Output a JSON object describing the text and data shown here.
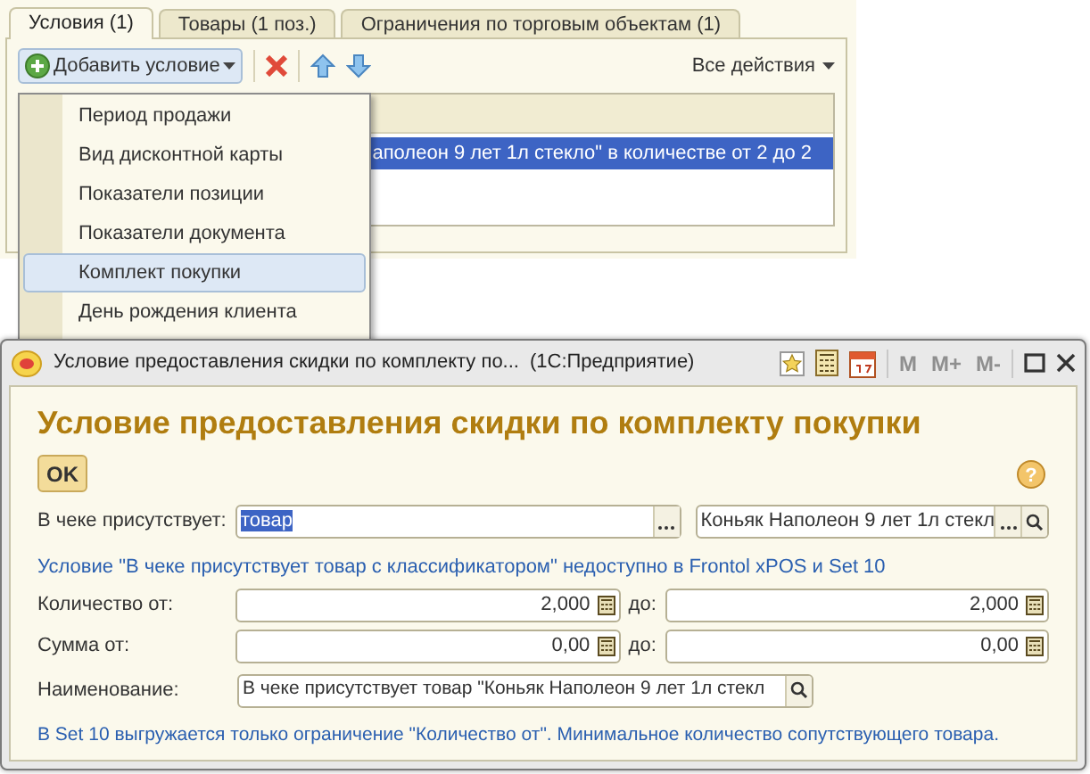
{
  "tabs": [
    {
      "label": "Условия (1)",
      "selected": true
    },
    {
      "label": "Товары (1 поз.)",
      "selected": false
    },
    {
      "label": "Ограничения по торговым объектам (1)",
      "selected": false
    }
  ],
  "toolbar": {
    "add_button": "Добавить условие",
    "all_actions": "Все действия"
  },
  "table": {
    "rows": [
      {
        "text": "аполеон 9 лет 1л стекло\" в количестве от 2 до 2",
        "selected": true
      }
    ]
  },
  "menu": {
    "items": [
      {
        "label": "Период продажи",
        "selected": false
      },
      {
        "label": "Вид дисконтной карты",
        "selected": false
      },
      {
        "label": "Показатели позиции",
        "selected": false
      },
      {
        "label": "Показатели документа",
        "selected": false
      },
      {
        "label": "Комплект покупки",
        "selected": true
      },
      {
        "label": "День рождения клиента",
        "selected": false
      }
    ]
  },
  "dialog": {
    "title": "Условие предоставления скидки по комплекту по...",
    "app": "(1С:Предприятие)",
    "memory_buttons": [
      {
        "label": "M",
        "disabled": true
      },
      {
        "label": "M+",
        "disabled": true
      },
      {
        "label": "M-",
        "disabled": true
      }
    ],
    "heading": "Условие предоставления скидки по комплекту покупки",
    "ok_button": "OK",
    "help_button": "?",
    "present": {
      "label": "В чеке присутствует:",
      "value": "товар",
      "value_selected": true,
      "item": "Коньяк Наполеон 9 лет 1л стекл"
    },
    "note_1": "Условие \"В чеке присутствует товар с классификатором\" недоступно в Frontol xPOS и Set 10",
    "ranges": [
      {
        "label": "Количество от:",
        "from": "2,000",
        "to_label": "до:",
        "to": "2,000"
      },
      {
        "label": "Сумма от:",
        "from": "0,00",
        "to_label": "до:",
        "to": "0,00"
      }
    ],
    "name": {
      "label": "Наименование:",
      "value": "В чеке присутствует товар \"Коньяк Наполеон 9 лет 1л стекл"
    },
    "note_2": "В Set 10 выгружается только ограничение \"Количество от\". Минимальное количество сопутствующего товара."
  }
}
